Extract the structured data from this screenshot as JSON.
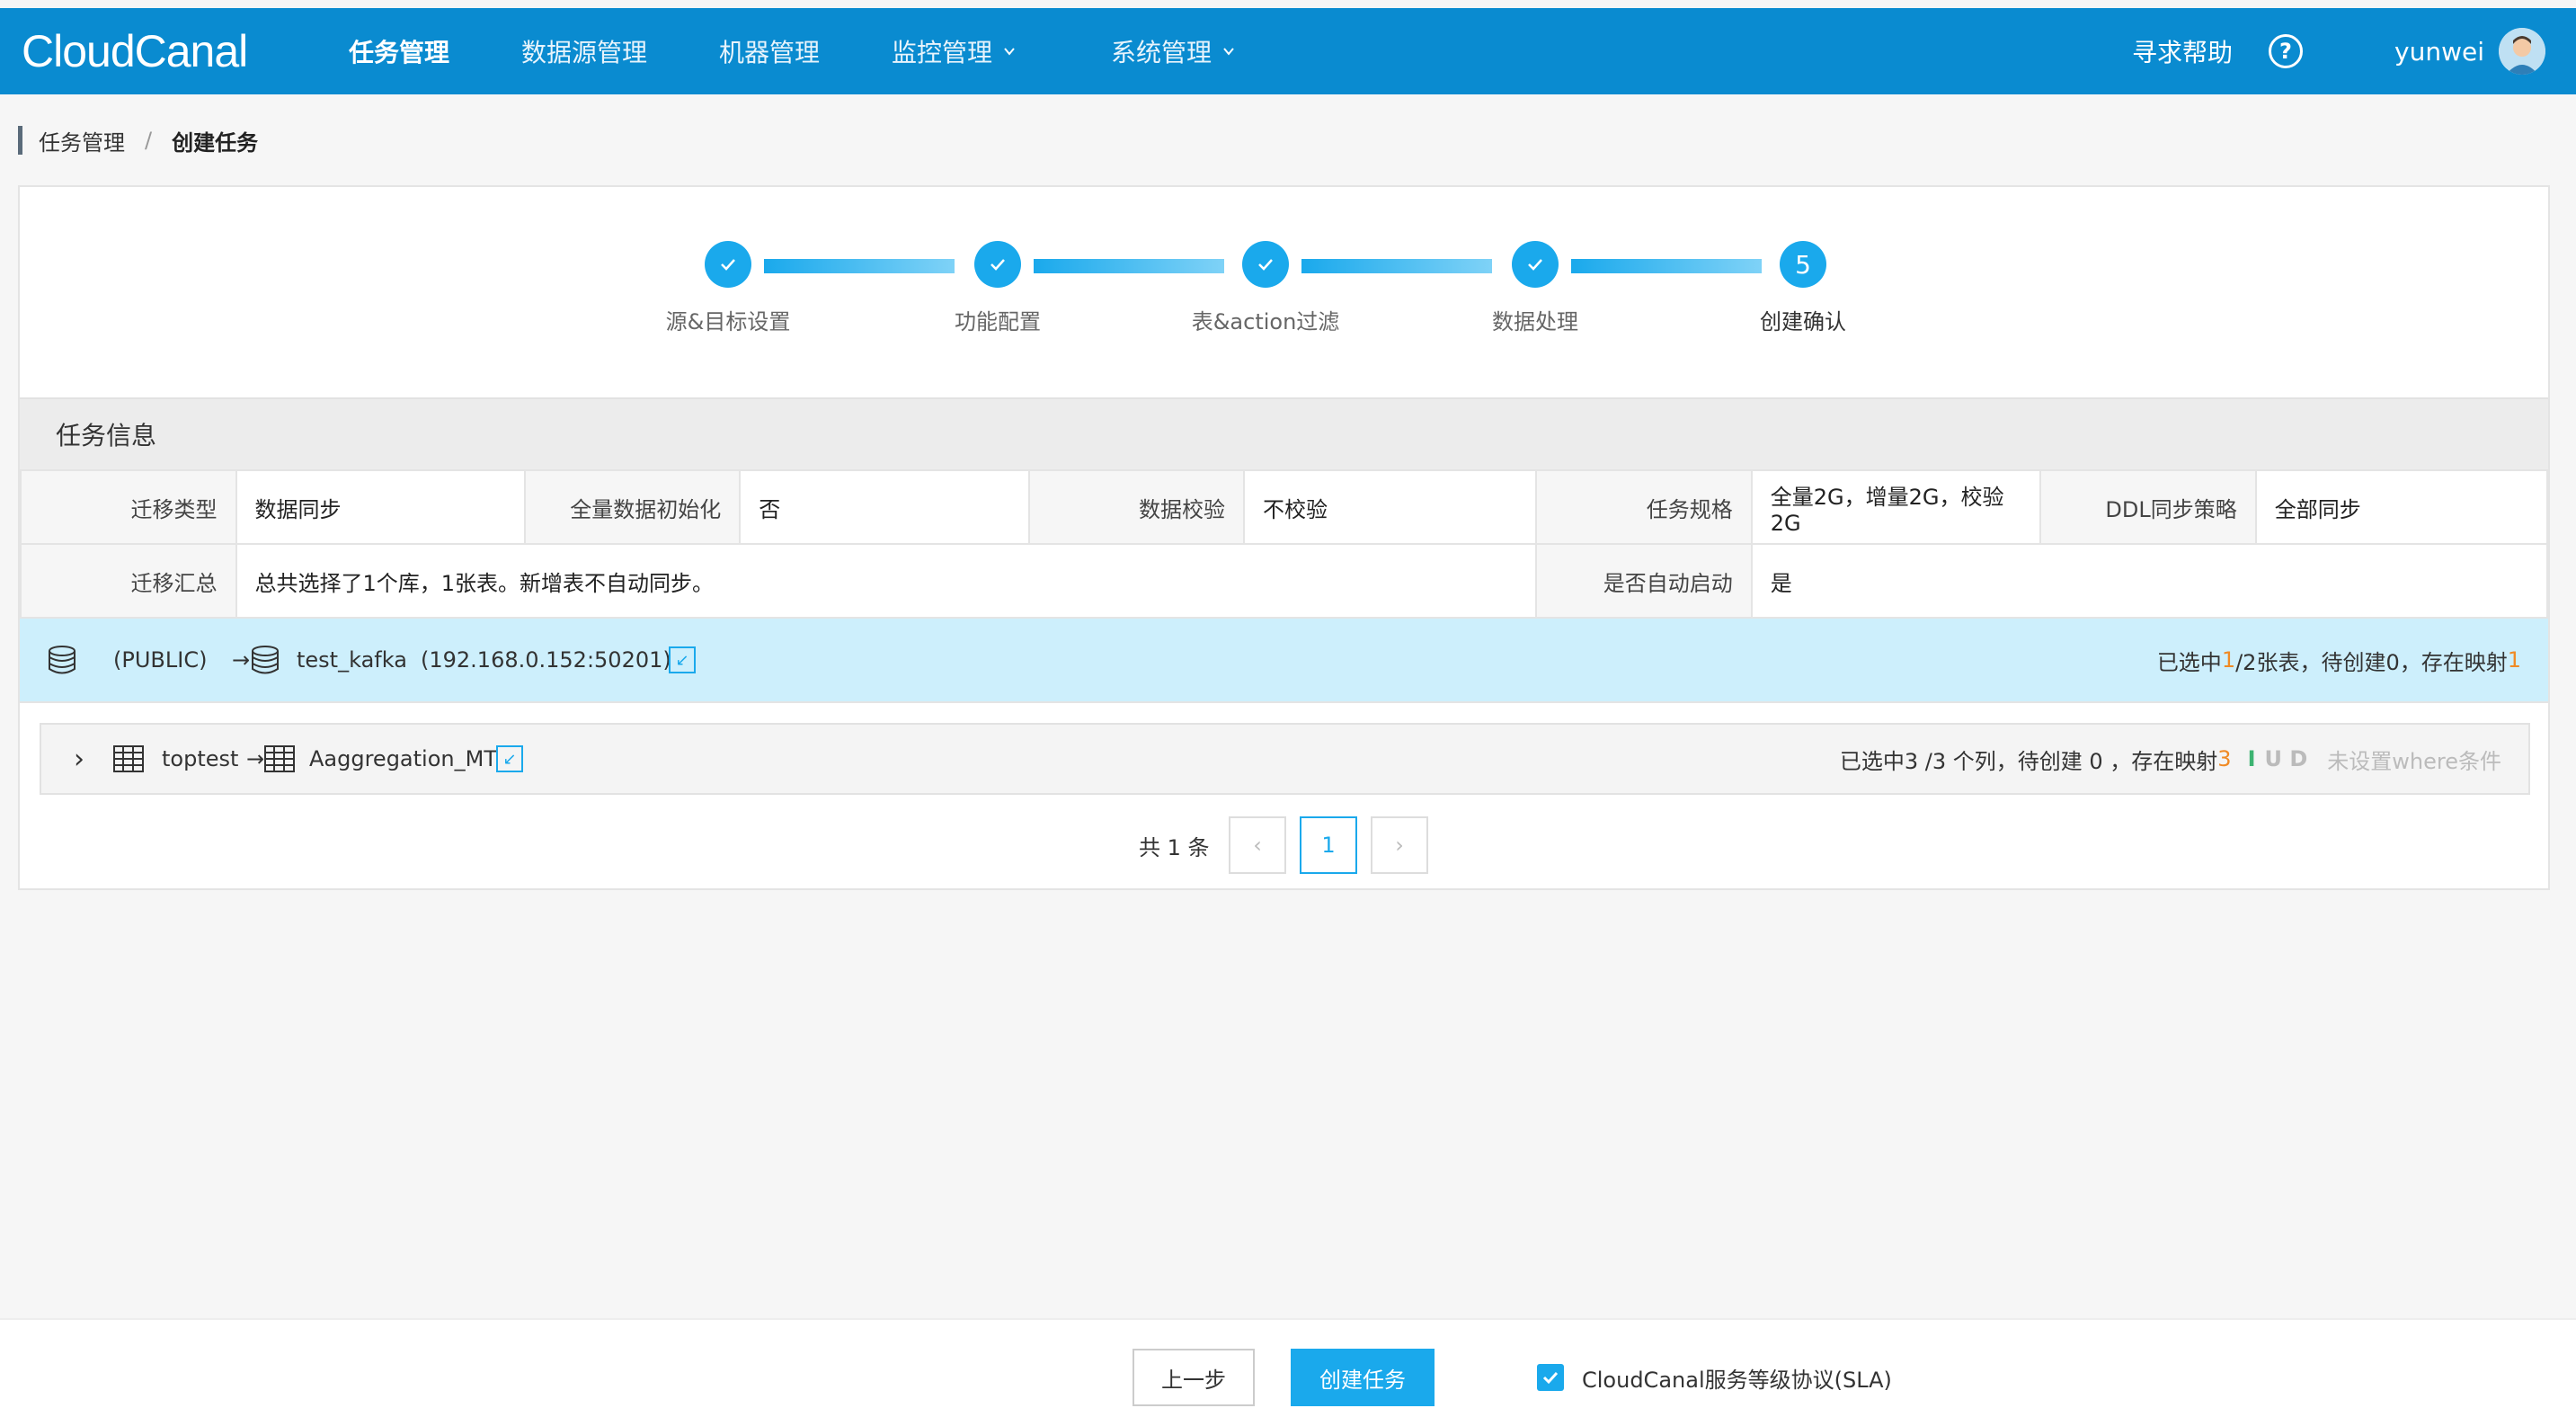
{
  "app": {
    "logo": "CloudCanal",
    "nav": [
      {
        "label": "任务管理",
        "active": true,
        "dropdown": false
      },
      {
        "label": "数据源管理",
        "active": false,
        "dropdown": false
      },
      {
        "label": "机器管理",
        "active": false,
        "dropdown": false
      },
      {
        "label": "监控管理",
        "active": false,
        "dropdown": true
      },
      {
        "label": "系统管理",
        "active": false,
        "dropdown": true
      }
    ],
    "help_label": "寻求帮助",
    "help_icon": "?",
    "username": "yunwei"
  },
  "breadcrumb": {
    "parent": "任务管理",
    "separator": "/",
    "current": "创建任务"
  },
  "steps": [
    {
      "label": "源&目标设置",
      "done": true
    },
    {
      "label": "功能配置",
      "done": true
    },
    {
      "label": "表&action过滤",
      "done": true
    },
    {
      "label": "数据处理",
      "done": true
    },
    {
      "label": "创建确认",
      "done": false,
      "number": "5"
    }
  ],
  "task_info": {
    "title": "任务信息",
    "row1": [
      {
        "label": "迁移类型",
        "value": "数据同步"
      },
      {
        "label": "全量数据初始化",
        "value": "否"
      },
      {
        "label": "数据校验",
        "value": "不校验"
      },
      {
        "label": "任务规格",
        "value": "全量2G，增量2G，校验2G"
      },
      {
        "label": "DDL同步策略",
        "value": "全部同步"
      }
    ],
    "row2": [
      {
        "label": "迁移汇总",
        "value": "总共选择了1个库，1张表。新增表不自动同步。"
      },
      {
        "label": "是否自动启动",
        "value": "是"
      }
    ]
  },
  "db_mapping": {
    "source": "(PUBLIC)",
    "arrow": "→",
    "target": "test_kafka",
    "target_addr": "(192.168.0.152:50201)",
    "summary_prefix": "已选中 ",
    "summary_selected": "1",
    "summary_mid": "/2张表，待创建0，存在映射",
    "summary_mapped": "1"
  },
  "table_mapping": {
    "expand": "›",
    "source": "toptest",
    "arrow": "→",
    "target": "Aaggregation_MT",
    "summary": "已选中3 /3 个列，待创建 0 ，存在映射 ",
    "mapped": "3",
    "action_i": "I",
    "action_ud": "U D",
    "where": "未设置where条件"
  },
  "pagination": {
    "total": "共 1 条",
    "prev": "‹",
    "page": "1",
    "next": "›"
  },
  "footer": {
    "prev_label": "上一步",
    "create_label": "创建任务",
    "sla_label": "CloudCanal服务等级协议(SLA)",
    "sla_checked": true
  }
}
